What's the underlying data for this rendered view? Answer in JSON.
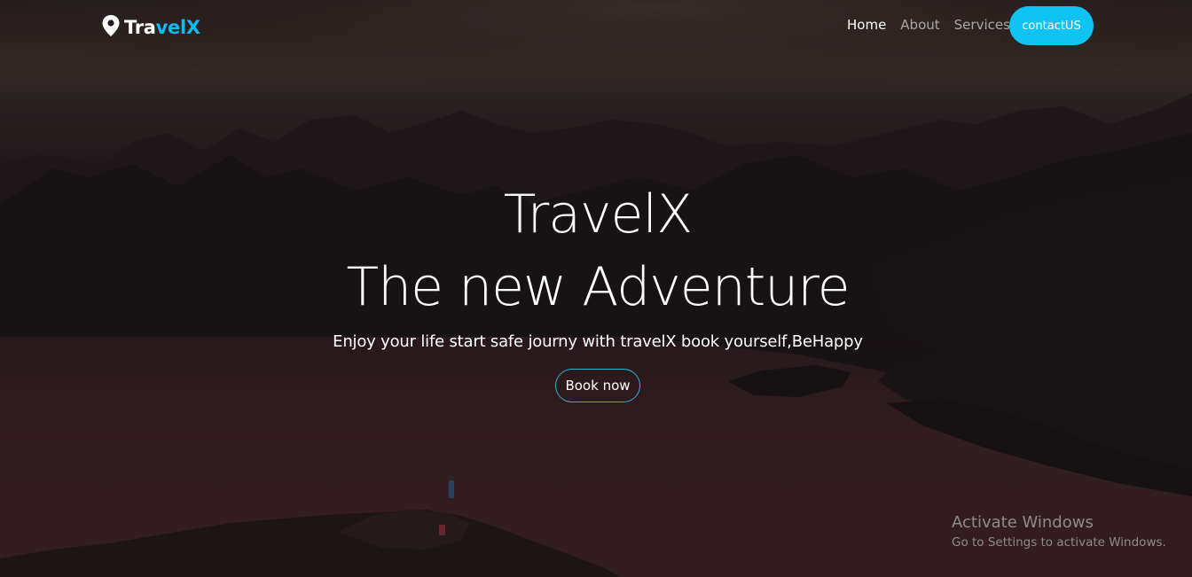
{
  "brand": {
    "part1": "Tra",
    "part2": "velX",
    "icon": "map-pin-icon",
    "accent_color": "#10b9f0"
  },
  "nav": {
    "links": [
      {
        "label": "Home",
        "active": true
      },
      {
        "label": "About",
        "active": false
      },
      {
        "label": "Services",
        "active": false
      }
    ],
    "contact_label": "contactUS",
    "contact_color": "#0fc3f2"
  },
  "hero": {
    "title_line1": "TravelX",
    "title_line2": "The new Adventure",
    "subtitle": "Enjoy your life start safe journy with travelX book yourself,BeHappy",
    "cta_label": "Book now",
    "cta_border_color": "#2ab3d8"
  },
  "watermark": {
    "title": "Activate Windows",
    "subtitle": "Go to Settings to activate Windows."
  }
}
